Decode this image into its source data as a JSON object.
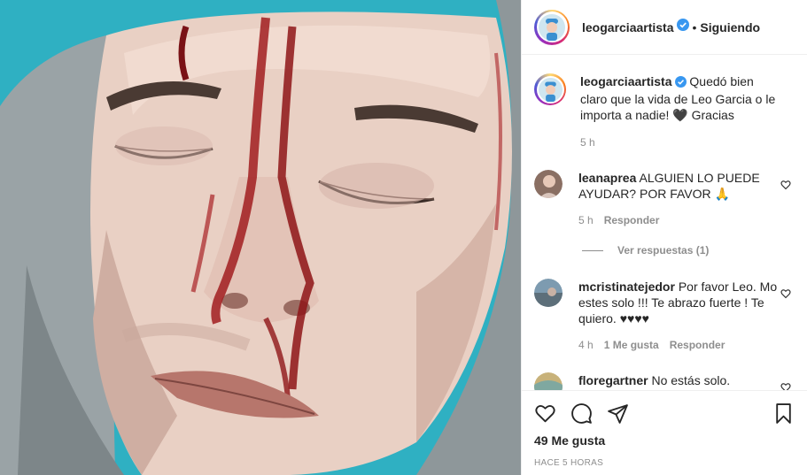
{
  "header": {
    "username": "leogarciaartista",
    "separator": "•",
    "follow_status": "Siguiendo"
  },
  "caption": {
    "username": "leogarciaartista",
    "text": "Quedó bien claro que la vida de Leo Garcia o le importa a nadie! 🖤 Gracias",
    "time": "5 h"
  },
  "comments": [
    {
      "username": "leanaprea",
      "text": "ALGUIEN LO PUEDE AYUDAR? POR FAVOR 🙏",
      "time": "5 h",
      "likes": "",
      "reply_label": "Responder"
    },
    {
      "username": "mcristinatejedor",
      "text": "Por favor Leo. Mo estes solo !!! Te abrazo fuerte ! Te quiero. ♥♥♥♥",
      "time": "4 h",
      "likes": "1 Me gusta",
      "reply_label": "Responder"
    },
    {
      "username": "floregartner",
      "text": "No estás solo.",
      "time": "",
      "likes": "",
      "reply_label": ""
    }
  ],
  "view_replies": "Ver respuestas (1)",
  "footer": {
    "likes": "49 Me gusta",
    "posted_ago": "HACE 5 HORAS"
  },
  "icons": {
    "like": "heart-icon",
    "comment": "comment-icon",
    "share": "share-icon",
    "save": "bookmark-icon",
    "verified": "verified-badge-icon"
  },
  "colors": {
    "verified": "#3897f0",
    "muted": "#8e8e8e",
    "text": "#262626"
  }
}
